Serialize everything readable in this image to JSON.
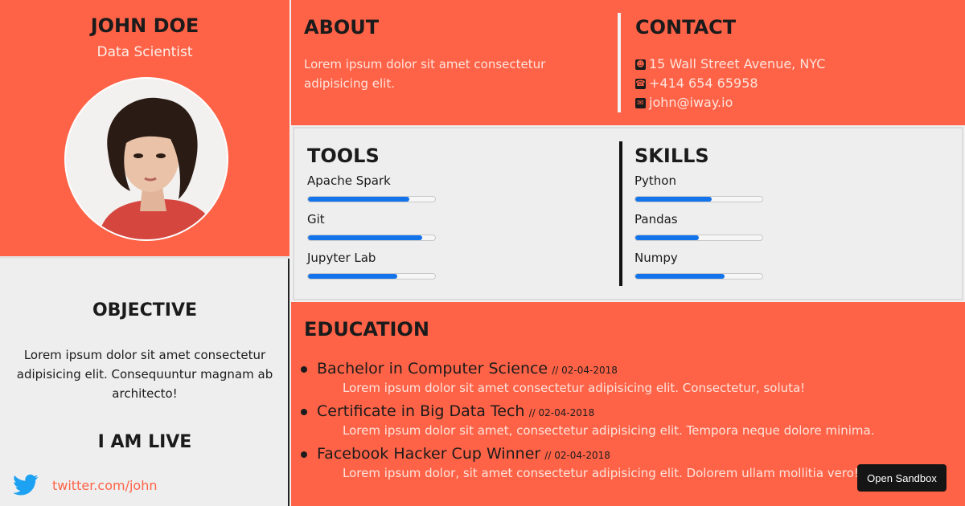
{
  "profile": {
    "name": "JOHN DOE",
    "role": "Data Scientist"
  },
  "objective": {
    "title": "OBJECTIVE",
    "text": "Lorem ipsum dolor sit amet consectetur adipisicing elit. Consequuntur magnam ab architecto!"
  },
  "live": {
    "title": "I AM LIVE",
    "twitter": "twitter.com/john"
  },
  "about": {
    "title": "ABOUT",
    "text": "Lorem ipsum dolor sit amet consectetur adipisicing elit."
  },
  "contact": {
    "title": "CONTACT",
    "items": [
      {
        "icon": "address-card-icon",
        "text": "15 Wall Street Avenue, NYC"
      },
      {
        "icon": "phone-icon",
        "text": "+414 654 65958"
      },
      {
        "icon": "envelope-icon",
        "text": "john@iway.io"
      }
    ]
  },
  "tools": {
    "title": "TOOLS",
    "items": [
      {
        "name": "Apache Spark",
        "level": 0.8
      },
      {
        "name": "Git",
        "level": 0.9
      },
      {
        "name": "Jupyter Lab",
        "level": 0.7
      }
    ]
  },
  "skills": {
    "title": "SKILLS",
    "items": [
      {
        "name": "Python",
        "level": 0.6
      },
      {
        "name": "Pandas",
        "level": 0.5
      },
      {
        "name": "Numpy",
        "level": 0.7
      }
    ]
  },
  "education": {
    "title": "EDUCATION",
    "items": [
      {
        "degree": "Bachelor in Computer Science",
        "date": "// 02-04-2018",
        "desc": "Lorem ipsum dolor sit amet consectetur adipisicing elit. Consectetur, soluta!"
      },
      {
        "degree": "Certificate in Big Data Tech",
        "date": "// 02-04-2018",
        "desc": "Lorem ipsum dolor sit amet, consectetur adipisicing elit. Tempora neque dolore minima."
      },
      {
        "degree": "Facebook Hacker Cup Winner",
        "date": "// 02-04-2018",
        "desc": "Lorem ipsum dolor, sit amet consectetur adipisicing elit. Dolorem ullam mollitia vero!"
      }
    ]
  },
  "sandbox": {
    "label": "Open Sandbox"
  },
  "colors": {
    "accent": "#ff6347",
    "bar": "#1273eb",
    "panel": "#eeeeee"
  }
}
